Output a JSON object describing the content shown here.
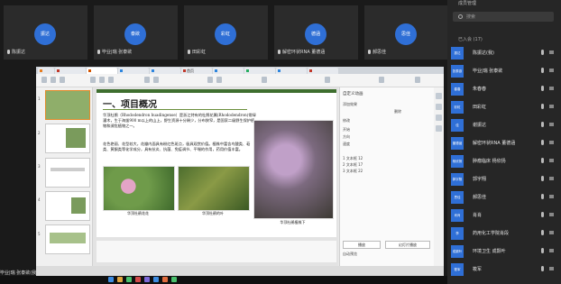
{
  "tiles": [
    {
      "avatar": "振达",
      "name": "陈振达"
    },
    {
      "avatar": "泰欲",
      "name": "毕业|瑞 张泰欲"
    },
    {
      "avatar": "彩虹",
      "name": "田彩虹"
    },
    {
      "avatar": "德涵",
      "name": "解密环状RNA 董德涵"
    },
    {
      "avatar": "思佳",
      "name": "郝思佳"
    }
  ],
  "share": {
    "tabs": [
      "",
      "",
      "",
      "首页",
      "",
      "",
      "",
      "",
      "",
      ""
    ],
    "slide": {
      "title": "一、项目概况",
      "para1": "华顶杜鹃（Rhododendron huadingense）是浙江特有的杜鹃花属(Rhododendron)常绿灌木，生于海拔900 m以上的山上，野生资源十分稀少，分布狭窄，是国家二级野生保护植物和濒危植物之一。",
      "para2": "花色艳丽、花型较大，花瓣内面具有粉红色斑点，极具观赏价值。植株中富含鸟酸类、萜类、黄酮类等化学成分，具有抗炎、抗菌、免疫调节、平喘的作用，药用价值丰富。",
      "captions": [
        "华顶杜鹃花花",
        "华顶杜鹃的叶",
        "华顶杜鹃植株下"
      ]
    },
    "pane": {
      "title": "自定义动画",
      "rows": [
        "添加效果",
        "删除",
        "修改",
        "开始",
        "方向",
        "速度",
        "1  文本框 12",
        "2  文本框 17",
        "3  文本框 22"
      ],
      "buttons": [
        "播放",
        "幻灯片播放"
      ],
      "check": "自动预览"
    }
  },
  "self_tag": "毕业|瑞 张泰欲(我)",
  "panel": {
    "title": "成员管理",
    "search_placeholder": "搜索",
    "joined": "已入会 (17)",
    "participants": [
      {
        "avatar": "振达",
        "name": "陈振达(我)"
      },
      {
        "avatar": "张泰欲",
        "name": "毕业|瑞 张泰欲"
      },
      {
        "avatar": "春春",
        "name": "朱春春"
      },
      {
        "avatar": "彩虹",
        "name": "田彩虹"
      },
      {
        "avatar": "佳",
        "name": "谢振达"
      },
      {
        "avatar": "董德涵",
        "name": "解密环状RNA 董德涵"
      },
      {
        "avatar": "杨欣扬",
        "name": "肿瘤临床 杨欣扬"
      },
      {
        "avatar": "郭宇翔",
        "name": "郭宇翔"
      },
      {
        "avatar": "思佳",
        "name": "郝思佳"
      },
      {
        "avatar": "肖肖",
        "name": "肖肖"
      },
      {
        "avatar": "李",
        "name": "药用化工学院肖段"
      },
      {
        "avatar": "成颢叶",
        "name": "环境卫生 成颢叶"
      },
      {
        "avatar": "筱军",
        "name": "筱军"
      }
    ]
  }
}
